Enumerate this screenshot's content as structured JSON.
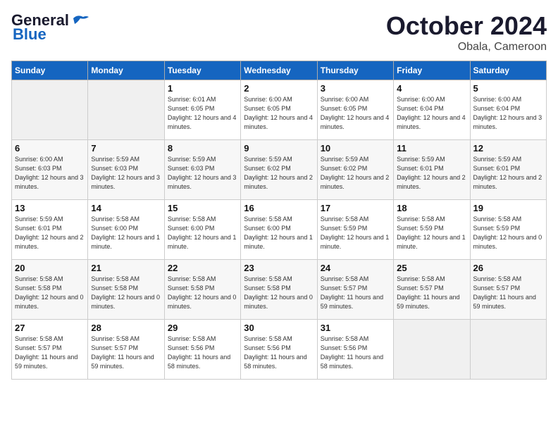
{
  "header": {
    "logo_general": "General",
    "logo_blue": "Blue",
    "month": "October 2024",
    "location": "Obala, Cameroon"
  },
  "days_of_week": [
    "Sunday",
    "Monday",
    "Tuesday",
    "Wednesday",
    "Thursday",
    "Friday",
    "Saturday"
  ],
  "weeks": [
    [
      {
        "day": "",
        "sunrise": "",
        "sunset": "",
        "daylight": "",
        "empty": true
      },
      {
        "day": "",
        "sunrise": "",
        "sunset": "",
        "daylight": "",
        "empty": true
      },
      {
        "day": "1",
        "sunrise": "Sunrise: 6:01 AM",
        "sunset": "Sunset: 6:05 PM",
        "daylight": "Daylight: 12 hours and 4 minutes.",
        "empty": false
      },
      {
        "day": "2",
        "sunrise": "Sunrise: 6:00 AM",
        "sunset": "Sunset: 6:05 PM",
        "daylight": "Daylight: 12 hours and 4 minutes.",
        "empty": false
      },
      {
        "day": "3",
        "sunrise": "Sunrise: 6:00 AM",
        "sunset": "Sunset: 6:05 PM",
        "daylight": "Daylight: 12 hours and 4 minutes.",
        "empty": false
      },
      {
        "day": "4",
        "sunrise": "Sunrise: 6:00 AM",
        "sunset": "Sunset: 6:04 PM",
        "daylight": "Daylight: 12 hours and 4 minutes.",
        "empty": false
      },
      {
        "day": "5",
        "sunrise": "Sunrise: 6:00 AM",
        "sunset": "Sunset: 6:04 PM",
        "daylight": "Daylight: 12 hours and 3 minutes.",
        "empty": false
      }
    ],
    [
      {
        "day": "6",
        "sunrise": "Sunrise: 6:00 AM",
        "sunset": "Sunset: 6:03 PM",
        "daylight": "Daylight: 12 hours and 3 minutes.",
        "empty": false
      },
      {
        "day": "7",
        "sunrise": "Sunrise: 5:59 AM",
        "sunset": "Sunset: 6:03 PM",
        "daylight": "Daylight: 12 hours and 3 minutes.",
        "empty": false
      },
      {
        "day": "8",
        "sunrise": "Sunrise: 5:59 AM",
        "sunset": "Sunset: 6:03 PM",
        "daylight": "Daylight: 12 hours and 3 minutes.",
        "empty": false
      },
      {
        "day": "9",
        "sunrise": "Sunrise: 5:59 AM",
        "sunset": "Sunset: 6:02 PM",
        "daylight": "Daylight: 12 hours and 2 minutes.",
        "empty": false
      },
      {
        "day": "10",
        "sunrise": "Sunrise: 5:59 AM",
        "sunset": "Sunset: 6:02 PM",
        "daylight": "Daylight: 12 hours and 2 minutes.",
        "empty": false
      },
      {
        "day": "11",
        "sunrise": "Sunrise: 5:59 AM",
        "sunset": "Sunset: 6:01 PM",
        "daylight": "Daylight: 12 hours and 2 minutes.",
        "empty": false
      },
      {
        "day": "12",
        "sunrise": "Sunrise: 5:59 AM",
        "sunset": "Sunset: 6:01 PM",
        "daylight": "Daylight: 12 hours and 2 minutes.",
        "empty": false
      }
    ],
    [
      {
        "day": "13",
        "sunrise": "Sunrise: 5:59 AM",
        "sunset": "Sunset: 6:01 PM",
        "daylight": "Daylight: 12 hours and 2 minutes.",
        "empty": false
      },
      {
        "day": "14",
        "sunrise": "Sunrise: 5:58 AM",
        "sunset": "Sunset: 6:00 PM",
        "daylight": "Daylight: 12 hours and 1 minute.",
        "empty": false
      },
      {
        "day": "15",
        "sunrise": "Sunrise: 5:58 AM",
        "sunset": "Sunset: 6:00 PM",
        "daylight": "Daylight: 12 hours and 1 minute.",
        "empty": false
      },
      {
        "day": "16",
        "sunrise": "Sunrise: 5:58 AM",
        "sunset": "Sunset: 6:00 PM",
        "daylight": "Daylight: 12 hours and 1 minute.",
        "empty": false
      },
      {
        "day": "17",
        "sunrise": "Sunrise: 5:58 AM",
        "sunset": "Sunset: 5:59 PM",
        "daylight": "Daylight: 12 hours and 1 minute.",
        "empty": false
      },
      {
        "day": "18",
        "sunrise": "Sunrise: 5:58 AM",
        "sunset": "Sunset: 5:59 PM",
        "daylight": "Daylight: 12 hours and 1 minute.",
        "empty": false
      },
      {
        "day": "19",
        "sunrise": "Sunrise: 5:58 AM",
        "sunset": "Sunset: 5:59 PM",
        "daylight": "Daylight: 12 hours and 0 minutes.",
        "empty": false
      }
    ],
    [
      {
        "day": "20",
        "sunrise": "Sunrise: 5:58 AM",
        "sunset": "Sunset: 5:58 PM",
        "daylight": "Daylight: 12 hours and 0 minutes.",
        "empty": false
      },
      {
        "day": "21",
        "sunrise": "Sunrise: 5:58 AM",
        "sunset": "Sunset: 5:58 PM",
        "daylight": "Daylight: 12 hours and 0 minutes.",
        "empty": false
      },
      {
        "day": "22",
        "sunrise": "Sunrise: 5:58 AM",
        "sunset": "Sunset: 5:58 PM",
        "daylight": "Daylight: 12 hours and 0 minutes.",
        "empty": false
      },
      {
        "day": "23",
        "sunrise": "Sunrise: 5:58 AM",
        "sunset": "Sunset: 5:58 PM",
        "daylight": "Daylight: 12 hours and 0 minutes.",
        "empty": false
      },
      {
        "day": "24",
        "sunrise": "Sunrise: 5:58 AM",
        "sunset": "Sunset: 5:57 PM",
        "daylight": "Daylight: 11 hours and 59 minutes.",
        "empty": false
      },
      {
        "day": "25",
        "sunrise": "Sunrise: 5:58 AM",
        "sunset": "Sunset: 5:57 PM",
        "daylight": "Daylight: 11 hours and 59 minutes.",
        "empty": false
      },
      {
        "day": "26",
        "sunrise": "Sunrise: 5:58 AM",
        "sunset": "Sunset: 5:57 PM",
        "daylight": "Daylight: 11 hours and 59 minutes.",
        "empty": false
      }
    ],
    [
      {
        "day": "27",
        "sunrise": "Sunrise: 5:58 AM",
        "sunset": "Sunset: 5:57 PM",
        "daylight": "Daylight: 11 hours and 59 minutes.",
        "empty": false
      },
      {
        "day": "28",
        "sunrise": "Sunrise: 5:58 AM",
        "sunset": "Sunset: 5:57 PM",
        "daylight": "Daylight: 11 hours and 59 minutes.",
        "empty": false
      },
      {
        "day": "29",
        "sunrise": "Sunrise: 5:58 AM",
        "sunset": "Sunset: 5:56 PM",
        "daylight": "Daylight: 11 hours and 58 minutes.",
        "empty": false
      },
      {
        "day": "30",
        "sunrise": "Sunrise: 5:58 AM",
        "sunset": "Sunset: 5:56 PM",
        "daylight": "Daylight: 11 hours and 58 minutes.",
        "empty": false
      },
      {
        "day": "31",
        "sunrise": "Sunrise: 5:58 AM",
        "sunset": "Sunset: 5:56 PM",
        "daylight": "Daylight: 11 hours and 58 minutes.",
        "empty": false
      },
      {
        "day": "",
        "sunrise": "",
        "sunset": "",
        "daylight": "",
        "empty": true
      },
      {
        "day": "",
        "sunrise": "",
        "sunset": "",
        "daylight": "",
        "empty": true
      }
    ]
  ]
}
